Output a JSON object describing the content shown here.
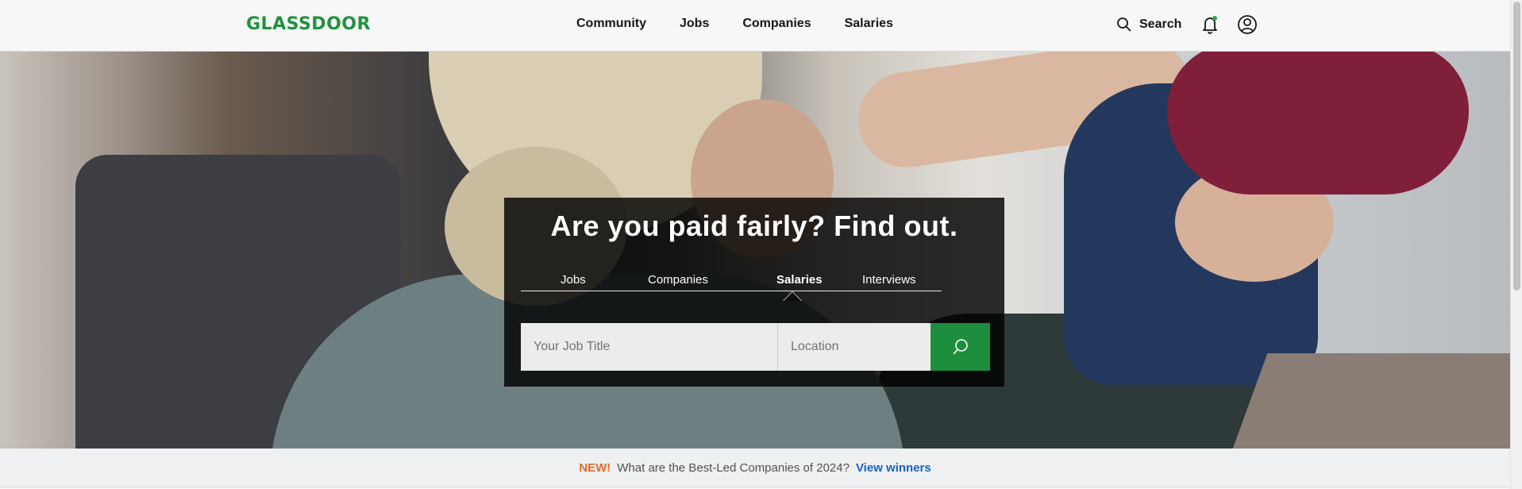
{
  "header": {
    "logo_text": "GLASSDOOR",
    "nav": [
      {
        "label": "Community"
      },
      {
        "label": "Jobs"
      },
      {
        "label": "Companies"
      },
      {
        "label": "Salaries"
      }
    ],
    "search_label": "Search",
    "icons": {
      "search": "search-icon",
      "bell": "bell-icon",
      "profile": "profile-icon"
    }
  },
  "hero": {
    "headline": "Are you paid fairly? Find out.",
    "tabs": [
      {
        "label": "Jobs",
        "active": false
      },
      {
        "label": "Companies",
        "active": false
      },
      {
        "label": "Salaries",
        "active": true
      },
      {
        "label": "Interviews",
        "active": false
      }
    ],
    "job_title_placeholder": "Your Job Title",
    "location_placeholder": "Location",
    "submit_icon": "search-icon"
  },
  "banner": {
    "new_label": "NEW!",
    "text": "What are the Best-Led Companies of 2024?",
    "link_label": "View winners"
  },
  "colors": {
    "brand_green": "#1d8e3c",
    "new_orange": "#e06d2a",
    "link_blue": "#1861bf"
  }
}
